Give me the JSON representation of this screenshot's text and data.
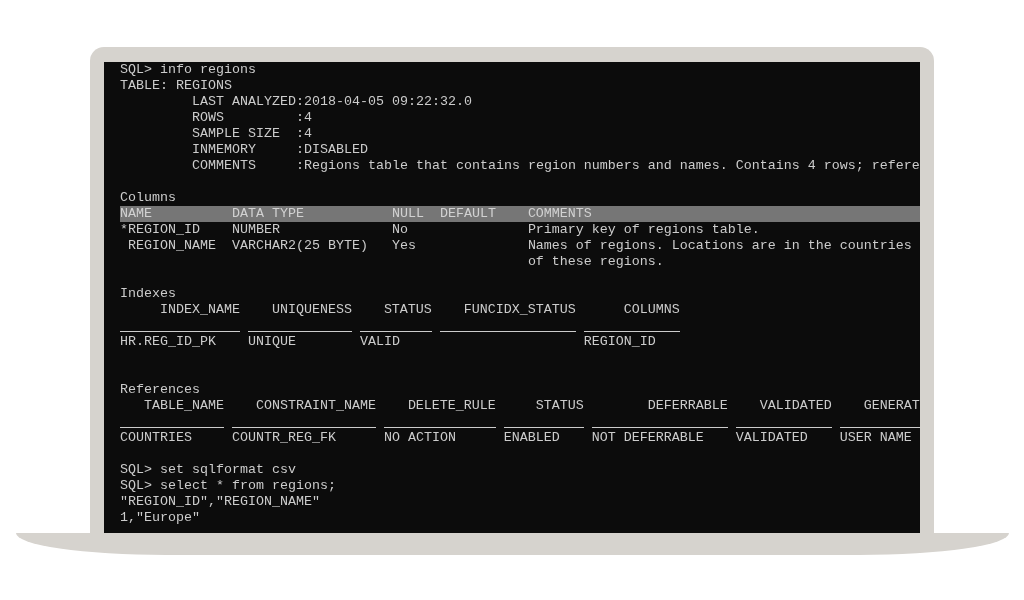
{
  "terminal": {
    "command": "SQL> info regions",
    "table_title": "TABLE: REGIONS",
    "properties": [
      {
        "label": "LAST ANALYZED",
        "value": ":2018-04-05 09:22:32.0"
      },
      {
        "label": "ROWS",
        "value": ":4"
      },
      {
        "label": "SAMPLE SIZE",
        "value": ":4"
      },
      {
        "label": "INMEMORY",
        "value": ":DISABLED"
      },
      {
        "label": "COMMENTS",
        "value": ":Regions table that contains region numbers and names. Contains 4 rows; refere"
      }
    ],
    "columns": {
      "title": "Columns",
      "headers": [
        "NAME",
        "DATA TYPE",
        "NULL",
        "DEFAULT",
        "COMMENTS"
      ],
      "rows": [
        {
          "primary_key": true,
          "name": "*REGION_ID",
          "data_type": "NUMBER",
          "nullable": "No",
          "comments": "Primary key of regions table."
        },
        {
          "primary_key": false,
          "name": "REGION_NAME",
          "data_type": "VARCHAR2(25 BYTE)",
          "nullable": "Yes",
          "comments": "Names of regions. Locations are in the countries of these regions."
        }
      ]
    },
    "indexes": {
      "title": "Indexes",
      "headers": [
        "INDEX_NAME",
        "UNIQUENESS",
        "STATUS",
        "FUNCIDX_STATUS",
        "COLUMNS"
      ],
      "rows": [
        {
          "index_name": "HR.REG_ID_PK",
          "uniqueness": "UNIQUE",
          "status": "VALID",
          "columns": "REGION_ID"
        }
      ]
    },
    "references": {
      "title": "References",
      "headers": [
        "TABLE_NAME",
        "CONSTRAINT_NAME",
        "DELETE_RULE",
        "STATUS",
        "DEFERRABLE",
        "VALIDATED",
        "GENERAT"
      ],
      "rows": [
        {
          "table_name": "COUNTRIES",
          "constraint_name": "COUNTR_REG_FK",
          "delete_rule": "NO ACTION",
          "status": "ENABLED",
          "deferrable": "NOT DEFERRABLE",
          "validated": "VALIDATED",
          "column_7": "USER NAME"
        }
      ]
    },
    "later_commands": [
      "SQL> set sqlformat csv",
      "SQL> select * from regions;"
    ],
    "output_lines": [
      "\"REGION_ID\",\"REGION_NAME\"",
      "1,\"Europe\""
    ]
  }
}
